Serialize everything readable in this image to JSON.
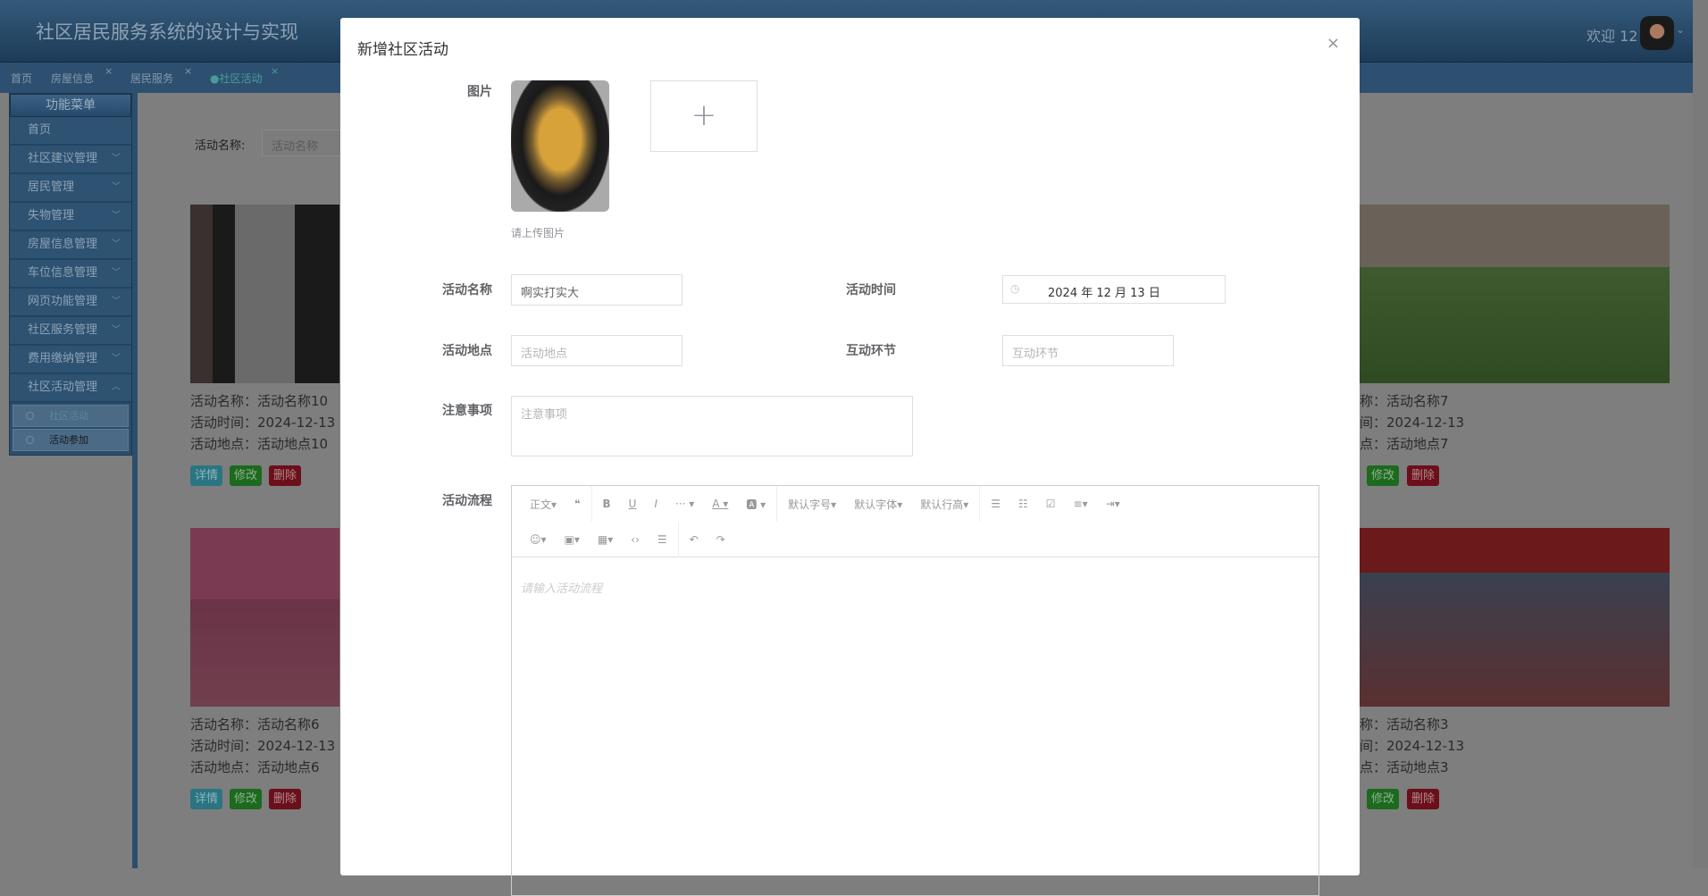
{
  "header": {
    "title": "社区居民服务系统的设计与实现",
    "welcome": "欢迎 12"
  },
  "tabs": [
    {
      "label": "首页"
    },
    {
      "label": "房屋信息",
      "close": "×"
    },
    {
      "label": "居民服务",
      "close": "×"
    },
    {
      "label": "●社区活动",
      "close": "×",
      "active": true
    }
  ],
  "sidebar": {
    "title": "功能菜单",
    "items": [
      "首页",
      "社区建议管理",
      "居民管理",
      "失物管理",
      "房屋信息管理",
      "车位信息管理",
      "网页功能管理",
      "社区服务管理",
      "费用缴纳管理",
      "社区活动管理"
    ],
    "sub_items": [
      "社区活动",
      "活动参加"
    ]
  },
  "search": {
    "label": "活动名称:",
    "placeholder": "活动名称"
  },
  "cards": [
    {
      "name": "活动名称：活动名称10",
      "time": "活动时间：2024-12-13",
      "place": "活动地点：活动地点10"
    },
    {
      "name": "称：活动名称7",
      "time": "间：2024-12-13",
      "place": "点：活动地点7"
    },
    {
      "name": "活动名称：活动名称6",
      "time": "活动时间：2024-12-13",
      "place": "活动地点：活动地点6"
    },
    {
      "name": "称：活动名称3",
      "time": "间：2024-12-13",
      "place": "点：活动地点3"
    }
  ],
  "card_buttons": {
    "detail": "详情",
    "edit": "修改",
    "delete": "删除"
  },
  "modal": {
    "title": "新增社区活动",
    "close": "×",
    "image_label": "图片",
    "upload_plus": "+",
    "upload_hint": "请上传图片",
    "name_label": "活动名称",
    "name_value": "啊实打实大",
    "time_label": "活动时间",
    "time_value": "2024 年 12 月 13 日",
    "place_label": "活动地点",
    "place_placeholder": "活动地点",
    "interact_label": "互动环节",
    "interact_placeholder": "互动环节",
    "notes_label": "注意事项",
    "notes_placeholder": "注意事项",
    "flow_label": "活动流程",
    "flow_placeholder": "请输入活动流程",
    "toolbar": {
      "para": "正文▾",
      "quote": "❝",
      "bold": "B",
      "underline": "U",
      "italic": "I",
      "more": "··· ▾",
      "color": "A ▾",
      "bg": "🅰 ▾",
      "size": "默认字号▾",
      "font": "默认字体▾",
      "lineheight": "默认行高▾",
      "ul": "☰",
      "ol": "☷",
      "todo": "☑",
      "align": "≡▾",
      "indent": "⇥▾",
      "emoji": "☺▾",
      "image": "▣▾",
      "table": "▦▾",
      "code": "‹›",
      "hr": "☰",
      "undo": "↶",
      "redo": "↷"
    }
  }
}
